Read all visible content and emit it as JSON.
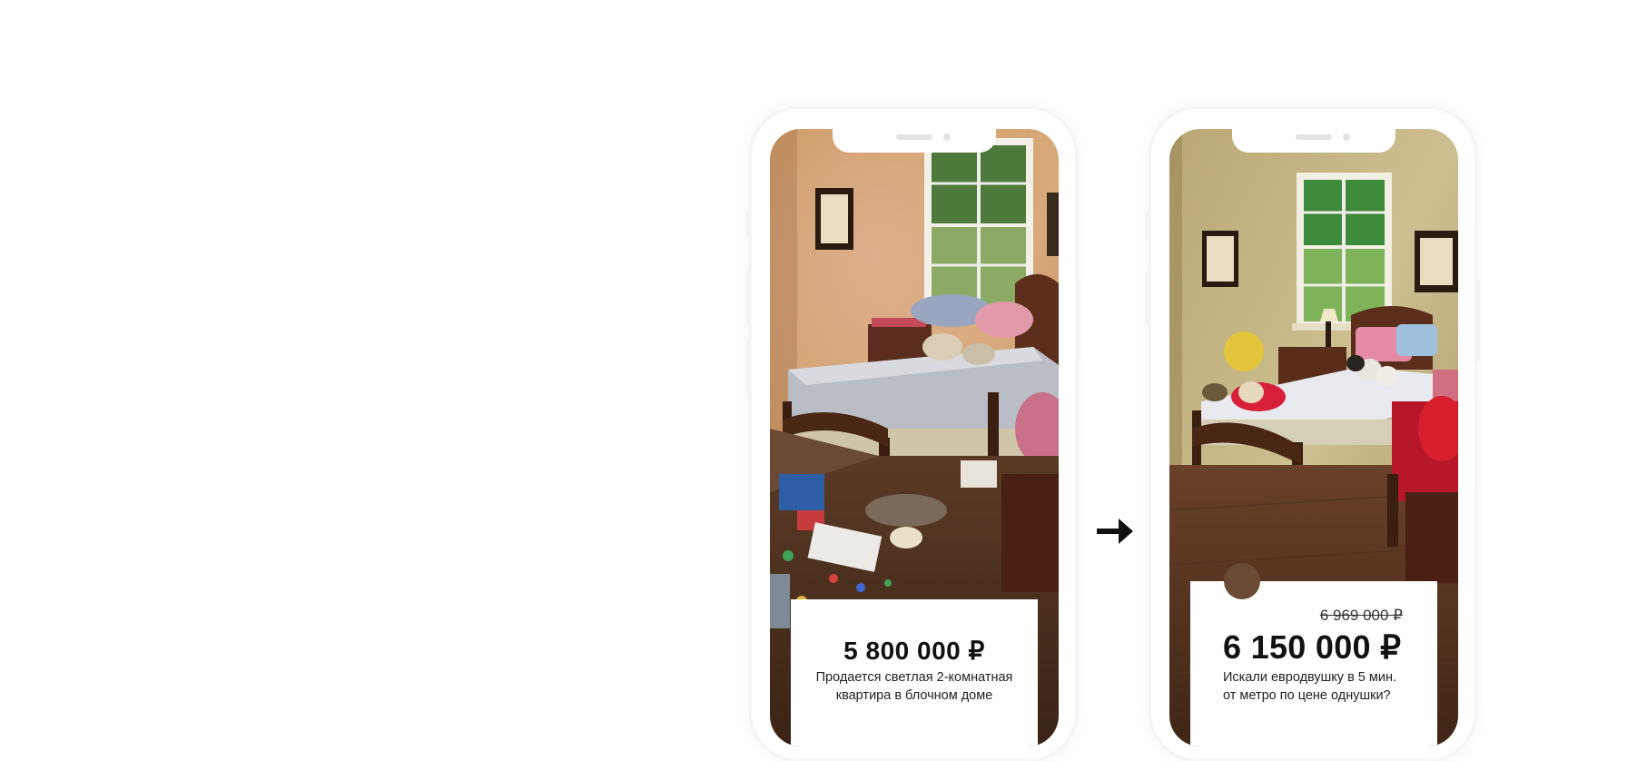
{
  "before": {
    "price": "5 800 000 ₽",
    "description_line1": "Продается светлая 2-комнатная",
    "description_line2": "квартира в блочном доме"
  },
  "after": {
    "old_price": "6 969 000 ₽",
    "price": "6 150 000 ₽",
    "description_line1": "Искали евродвушку в 5 мин.",
    "description_line2": "от метро по цене однушки?"
  },
  "icons": {
    "arrow": "arrow-right-icon"
  },
  "colors": {
    "background": "#ffffff",
    "text": "#111111",
    "card": "#ffffff"
  }
}
